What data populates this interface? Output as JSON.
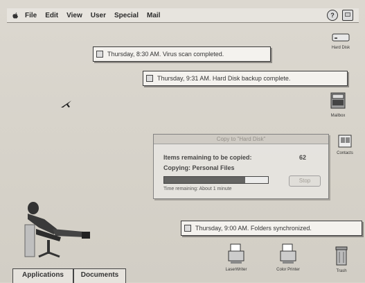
{
  "menubar": {
    "items": [
      "File",
      "Edit",
      "View",
      "User",
      "Special",
      "Mail"
    ],
    "help_label": "?"
  },
  "notifications": [
    "Thursday, 8:30 AM. Virus scan completed.",
    "Thursday, 9:31 AM. Hard Disk backup complete.",
    "Thursday, 9:00 AM. Folders synchronized."
  ],
  "copy_dialog": {
    "title": "Copy to \"Hard Disk\"",
    "remaining_label": "Items remaining to be copied:",
    "remaining_count": "62",
    "copying_label": "Copying: Personal Files",
    "progress": 0.78,
    "time_remaining": "Time remaining: About 1 minute",
    "stop_label": "Stop"
  },
  "desktop_icons": {
    "hard_disk": "Hard Disk",
    "mailbox": "Mailbox",
    "contacts": "Contacts",
    "laserwriter": "LaserWriter",
    "color_printer": "Color Printer",
    "trash": "Trash"
  },
  "tabs": [
    "Applications",
    "Documents"
  ]
}
